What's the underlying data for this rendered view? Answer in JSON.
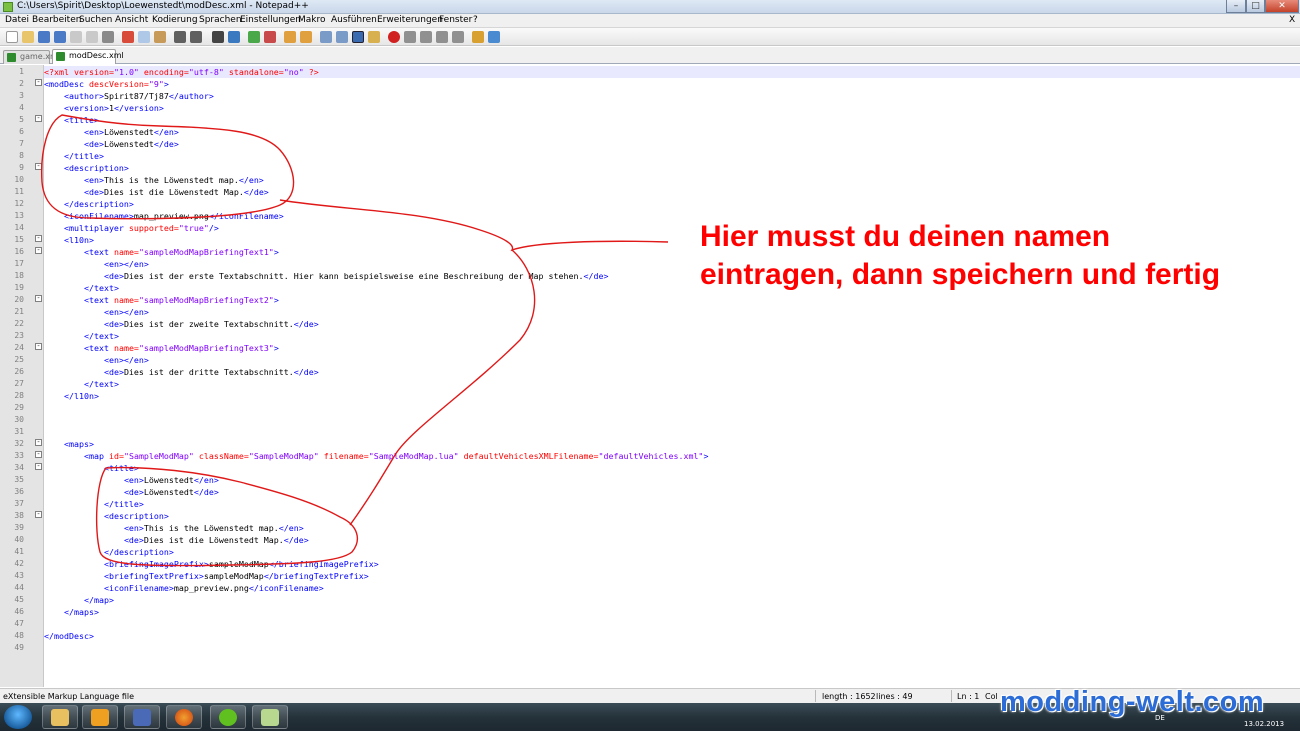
{
  "window": {
    "title": "C:\\Users\\Spirit\\Desktop\\Loewenstedt\\modDesc.xml - Notepad++"
  },
  "menu": [
    "Datei",
    "Bearbeiten",
    "Suchen",
    "Ansicht",
    "Kodierung",
    "Sprachen",
    "Einstellungen",
    "Makro",
    "Ausführen",
    "Erweiterungen",
    "Fenster",
    "?"
  ],
  "menu_close": "X",
  "tabs": [
    {
      "label": "game.xml",
      "active": false
    },
    {
      "label": "modDesc.xml",
      "active": true
    }
  ],
  "editor": {
    "line_numbers": [
      "1",
      "2",
      "3",
      "4",
      "5",
      "6",
      "7",
      "8",
      "9",
      "10",
      "11",
      "12",
      "13",
      "14",
      "15",
      "16",
      "17",
      "18",
      "19",
      "20",
      "21",
      "22",
      "23",
      "24",
      "25",
      "26",
      "27",
      "28",
      "29",
      "30",
      "31",
      "32",
      "33",
      "34",
      "35",
      "36",
      "37",
      "38",
      "39",
      "40",
      "41",
      "42",
      "43",
      "44",
      "45",
      "46",
      "47",
      "48",
      "49"
    ]
  },
  "code": {
    "l1_pi": "<?xml ",
    "l1_a1": "version=",
    "l1_v1": "\"1.0\"",
    "l1_a2": " encoding=",
    "l1_v2": "\"utf-8\"",
    "l1_a3": " standalone=",
    "l1_v3": "\"no\"",
    "l1_end": " ?>",
    "l2_t": "<modDesc ",
    "l2_a": "descVersion=",
    "l2_v": "\"9\"",
    "l2_e": ">",
    "l3_o": "<author>",
    "l3_x": "Spirit87/Tj87",
    "l3_c": "</author>",
    "l4_o": "<version>",
    "l4_x": "1",
    "l4_c": "</version>",
    "title_o": "<title>",
    "title_c": "</title>",
    "en_o": "<en>",
    "en_c": "</en>",
    "de_o": "<de>",
    "de_c": "</de>",
    "name": "Löwenstedt",
    "desc_o": "<description>",
    "desc_c": "</description>",
    "desc_en": "This is the Löwenstedt map.",
    "desc_de": "Dies ist die Löwenstedt Map.",
    "l13_o": "<iconFilename>",
    "l13_x": "map_preview.png",
    "l13_c": "</iconFilename>",
    "l14_t": "<multiplayer ",
    "l14_a": "supported=",
    "l14_v": "\"true\"",
    "l14_e": "/>",
    "l15": "<l10n>",
    "text_t": "<text ",
    "text_a": "name=",
    "text_v1": "\"sampleModMapBriefingText1\"",
    "text_v2": "\"sampleModMapBriefingText2\"",
    "text_v3": "\"sampleModMapBriefingText3\"",
    "gt": ">",
    "en_empty": "<en></en>",
    "t1_de": "Dies ist der erste Textabschnitt. Hier kann beispielsweise eine Beschreibung der Map stehen.",
    "t2_de": "Dies ist der zweite Textabschnitt.",
    "t3_de": "Dies ist der dritte Textabschnitt.",
    "text_c": "</text>",
    "l28": "</l10n>",
    "l32": "<maps>",
    "l33_t": "<map ",
    "l33_a1": "id=",
    "l33_v1": "\"SampleModMap\"",
    "l33_a2": " className=",
    "l33_v2": "\"SampleModMap\"",
    "l33_a3": " filename=",
    "l33_v3": "\"SampleModMap.lua\"",
    "l33_a4": " defaultVehiclesXMLFilename=",
    "l33_v4": "\"defaultVehicles.xml\"",
    "l42_o": "<briefingImagePrefix>",
    "l42_x": "sampleModMap",
    "l42_c": "</briefingImagePrefix>",
    "l43_o": "<briefingTextPrefix>",
    "l43_x": "sampleModMap",
    "l43_c": "</briefingTextPrefix>",
    "l44_o": "<iconFilename>",
    "l44_x": "map_preview.png",
    "l44_c": "</iconFilename>",
    "l45": "</map>",
    "l46": "</maps>",
    "l48": "</modDesc>"
  },
  "annotation": {
    "line1": "Hier musst du deinen namen",
    "line2": "eintragen, dann speichern und fertig"
  },
  "status": {
    "file_type": "eXtensible Markup Language file",
    "length": "length : 1652",
    "lines": "lines : 49",
    "ln": "Ln : 1",
    "col": "Col"
  },
  "taskbar": {
    "lang": "DE",
    "date": "13.02.2013"
  },
  "watermark": "modding-welt.com",
  "colors": {
    "tag": "#0000ff",
    "attribute": "#ff0000",
    "value": "#8000ff",
    "annotation": "#ff0000",
    "watermark": "#2b6cd6"
  }
}
